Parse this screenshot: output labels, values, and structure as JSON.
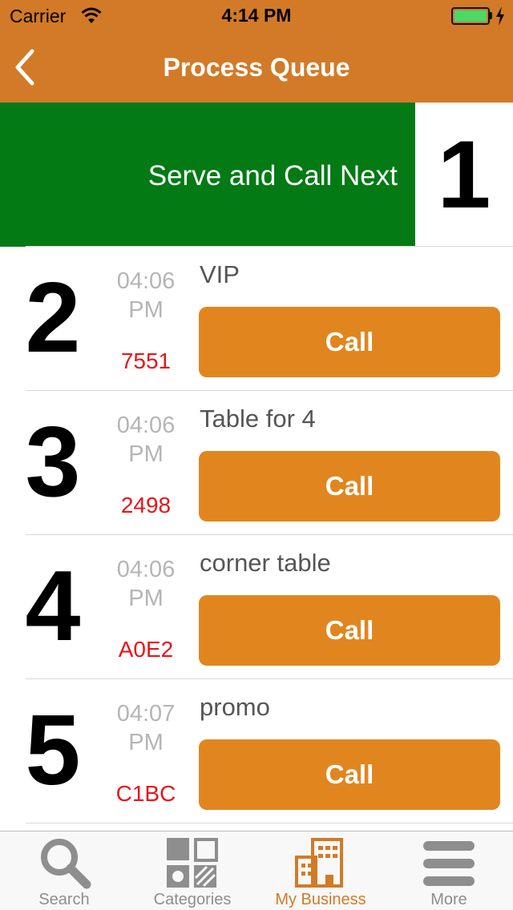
{
  "status_bar": {
    "carrier": "Carrier",
    "time": "4:14 PM"
  },
  "nav": {
    "title": "Process Queue",
    "back_icon": "chevron-left-icon"
  },
  "serve": {
    "label": "Serve and Call Next",
    "current_number": "1"
  },
  "queue": [
    {
      "number": "2",
      "time_line1": "04:06",
      "time_line2": "PM",
      "code": "7551",
      "note": "VIP",
      "button_label": "Call"
    },
    {
      "number": "3",
      "time_line1": "04:06",
      "time_line2": "PM",
      "code": "2498",
      "note": "Table for 4",
      "button_label": "Call"
    },
    {
      "number": "4",
      "time_line1": "04:06",
      "time_line2": "PM",
      "code": "A0E2",
      "note": "corner table",
      "button_label": "Call"
    },
    {
      "number": "5",
      "time_line1": "04:07",
      "time_line2": "PM",
      "code": "C1BC",
      "note": "promo",
      "button_label": "Call"
    }
  ],
  "tabs": [
    {
      "label": "Search",
      "icon": "search-icon"
    },
    {
      "label": "Categories",
      "icon": "categories-icon"
    },
    {
      "label": "My Business",
      "icon": "building-icon",
      "active": true
    },
    {
      "label": "More",
      "icon": "menu-icon"
    }
  ],
  "colors": {
    "nav_bar": "#d27a27",
    "serve_button": "#047a15",
    "call_button": "#e1861e",
    "code_text": "#e8141b",
    "active_tab": "#d27a27"
  }
}
